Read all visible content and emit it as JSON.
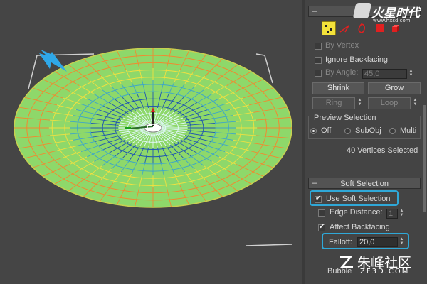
{
  "rollouts": {
    "selection": {
      "collapse_symbol": "–"
    },
    "soft_selection": {
      "collapse_symbol": "–",
      "title": "Soft Selection"
    }
  },
  "subobject_icons": [
    "vertex-icon",
    "edge-icon",
    "border-icon",
    "polygon-icon",
    "element-icon"
  ],
  "selection": {
    "by_vertex": {
      "label": "By Vertex",
      "checked": false
    },
    "ignore_backfacing": {
      "label": "Ignore Backfacing",
      "checked": false
    },
    "by_angle": {
      "label": "By Angle:",
      "value": "45,0",
      "checked": false
    },
    "buttons": {
      "shrink": "Shrink",
      "grow": "Grow",
      "ring": "Ring",
      "loop": "Loop"
    },
    "preview": {
      "title": "Preview Selection",
      "options": [
        "Off",
        "SubObj",
        "Multi"
      ],
      "selected": "Off"
    },
    "status": "40 Vertices Selected"
  },
  "soft_selection": {
    "use_soft_selection": {
      "label": "Use Soft Selection",
      "checked": true
    },
    "edge_distance": {
      "label": "Edge Distance:",
      "value": "1",
      "checked": false
    },
    "affect_backfacing": {
      "label": "Affect Backfacing",
      "checked": true
    },
    "falloff": {
      "label": "Falloff:",
      "value": "20,0"
    },
    "bubble_partial": "Bubble"
  },
  "watermarks": {
    "top": {
      "logo_text": "火星时代",
      "url": "www.hxsd.com"
    },
    "bottom": {
      "logo_text": "朱峰社区",
      "url": "ZF3D.COM"
    }
  },
  "colors": {
    "accent_highlight": "#2fa8d8",
    "mesh_fill": "#8ed86a",
    "selected_vertices": "#1f57b0",
    "arrow": "#2fa8e8"
  }
}
